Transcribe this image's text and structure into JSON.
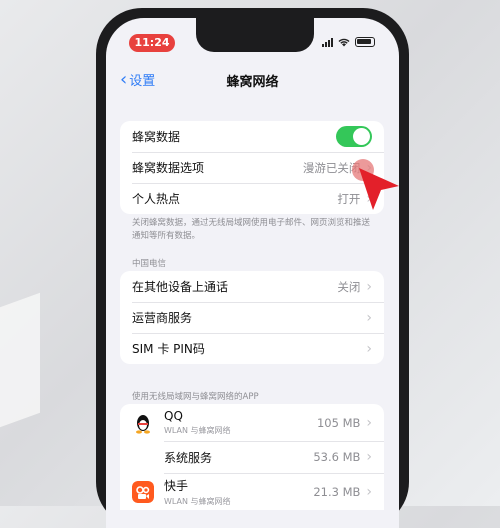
{
  "status_bar": {
    "time": "11:24"
  },
  "nav": {
    "back_label": "设置",
    "title": "蜂窝网络"
  },
  "group1": {
    "cellular_data": {
      "label": "蜂窝数据"
    },
    "options": {
      "label": "蜂窝数据选项",
      "value": "漫游已关闭"
    },
    "hotspot": {
      "label": "个人热点",
      "value": "打开"
    }
  },
  "note": "关闭蜂窝数据，通过无线局域网使用电子邮件、网页浏览和推送通知等所有数据。",
  "carrier": {
    "section": "中国电信",
    "other_devices": {
      "label": "在其他设备上通话",
      "value": "关闭"
    },
    "carrier_services": {
      "label": "运营商服务"
    },
    "sim_pin": {
      "label": "SIM 卡 PIN码"
    }
  },
  "apps": {
    "section": "使用无线局域网与蜂窝网络的APP",
    "items": [
      {
        "name": "QQ",
        "sub": "WLAN 与蜂窝网络",
        "size": "105 MB"
      },
      {
        "name": "系统服务",
        "sub": "",
        "size": "53.6 MB"
      },
      {
        "name": "快手",
        "sub": "WLAN 与蜂窝网络",
        "size": "21.3 MB"
      }
    ]
  },
  "colors": {
    "toggle_on": "#34c759",
    "link": "#2f7cf6",
    "time_pill": "#e8413e"
  }
}
